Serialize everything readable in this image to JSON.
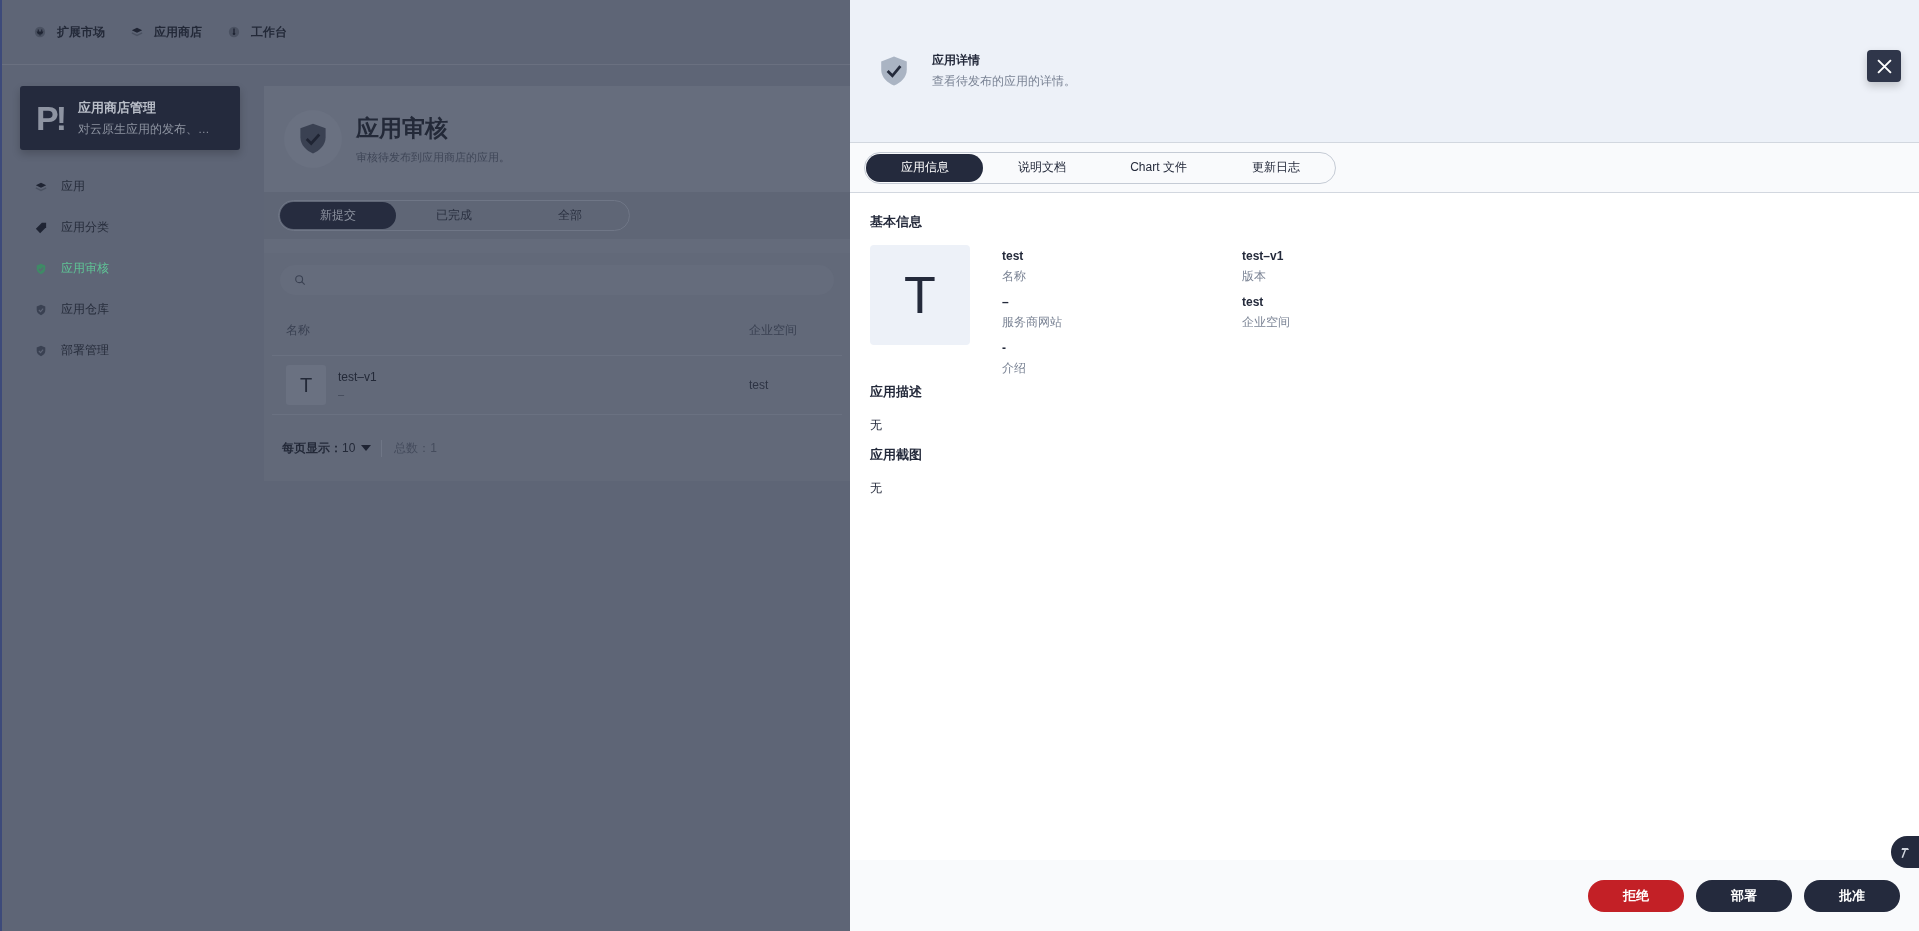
{
  "top_nav": [
    {
      "label": "扩展市场",
      "kind": "plug"
    },
    {
      "label": "应用商店",
      "kind": "layers"
    },
    {
      "label": "工作台",
      "kind": "dial"
    }
  ],
  "sidebar": {
    "logo": "P!",
    "title": "应用商店管理",
    "subtitle": "对云原生应用的发布、…",
    "items": [
      {
        "label": "应用",
        "kind": "layers",
        "selected": false
      },
      {
        "label": "应用分类",
        "kind": "tag",
        "selected": false
      },
      {
        "label": "应用审核",
        "kind": "shield",
        "selected": true
      },
      {
        "label": "应用仓库",
        "kind": "shield",
        "selected": false
      },
      {
        "label": "部署管理",
        "kind": "shield",
        "selected": false
      }
    ]
  },
  "page": {
    "title": "应用审核",
    "subtitle": "审核待发布到应用商店的应用。",
    "filter_tabs": [
      {
        "label": "新提交",
        "selected": true
      },
      {
        "label": "已完成",
        "selected": false
      },
      {
        "label": "全部",
        "selected": false
      }
    ],
    "table": {
      "columns": [
        "名称",
        "企业空间"
      ],
      "rows": [
        {
          "avatar": "T",
          "name": "test–v1",
          "subtitle": "–",
          "workspace": "test"
        }
      ]
    },
    "pagination": {
      "per_page_label": "每页显示：",
      "per_page": "10",
      "total": "总数：1"
    }
  },
  "drawer": {
    "title": "应用详情",
    "subtitle": "查看待发布的应用的详情。",
    "tabs": [
      {
        "label": "应用信息",
        "selected": true
      },
      {
        "label": "说明文档",
        "selected": false
      },
      {
        "label": "Chart 文件",
        "selected": false
      },
      {
        "label": "更新日志",
        "selected": false
      }
    ],
    "basic_info": {
      "title": "基本信息",
      "avatar": "T",
      "fields": [
        {
          "value": "test",
          "label": "名称"
        },
        {
          "value": "test–v1",
          "label": "版本"
        },
        {
          "value": "–",
          "label": "服务商网站"
        },
        {
          "value": "test",
          "label": "企业空间"
        },
        {
          "value": "-",
          "label": "介绍"
        }
      ]
    },
    "sections": [
      {
        "title": "应用描述",
        "text": "无"
      },
      {
        "title": "应用截图",
        "text": "无"
      }
    ],
    "buttons": [
      {
        "label": "拒绝",
        "kind": "danger"
      },
      {
        "label": "部署",
        "kind": "primary"
      },
      {
        "label": "批准",
        "kind": "primary"
      }
    ]
  }
}
